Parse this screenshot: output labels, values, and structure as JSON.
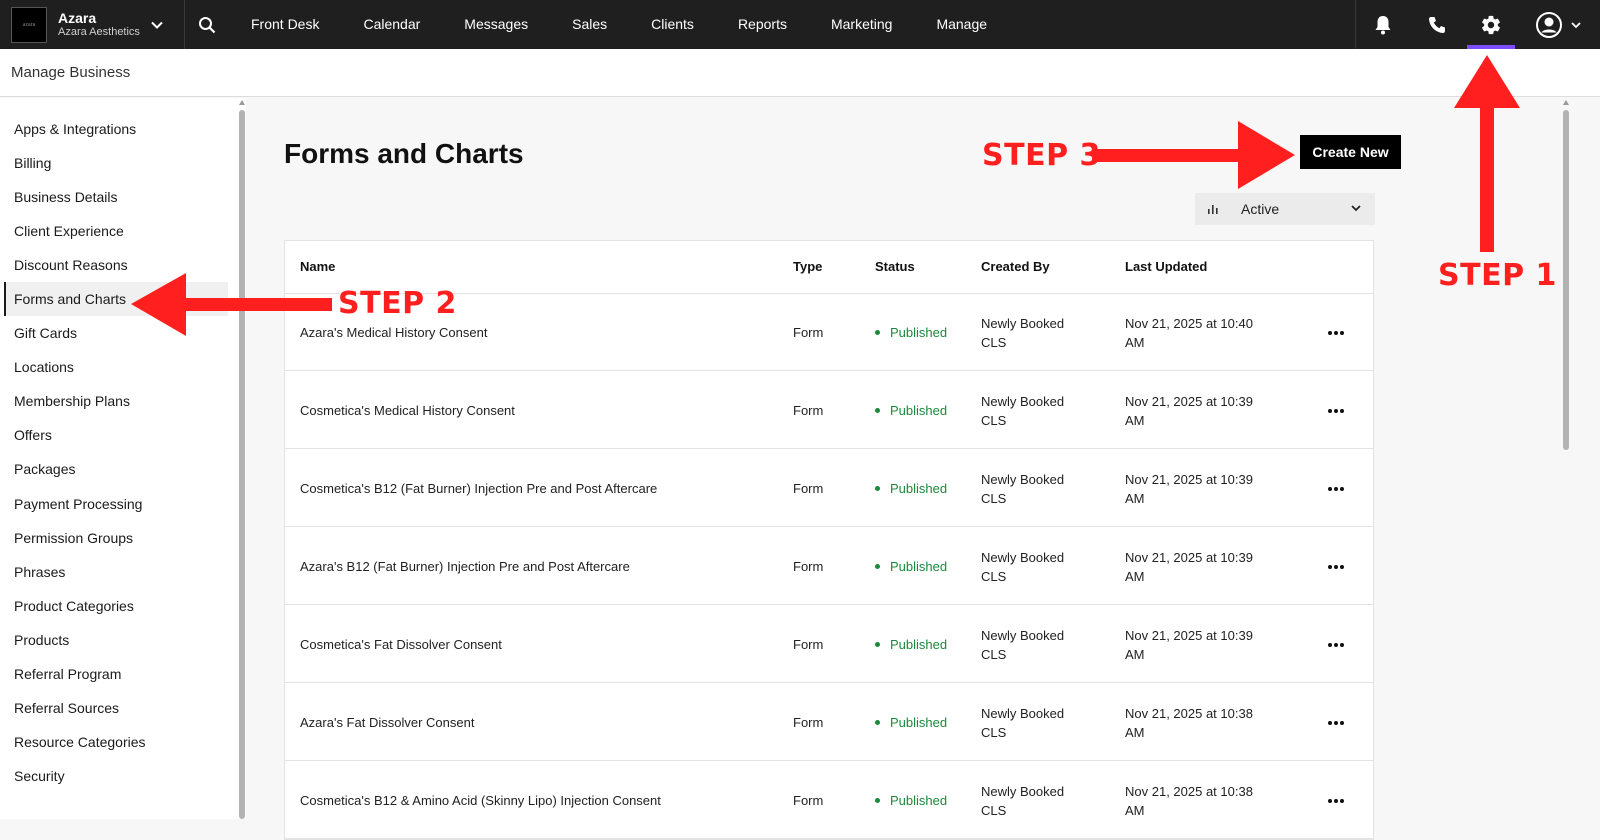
{
  "topbar": {
    "brand_name": "Azara",
    "brand_sub": "Azara Aesthetics",
    "nav": [
      "Front Desk",
      "Calendar",
      "Messages",
      "Sales",
      "Clients",
      "Reports",
      "Marketing",
      "Manage"
    ],
    "accent": "#7b4dff"
  },
  "subheader": {
    "title": "Manage Business"
  },
  "sidebar": {
    "items": [
      "Apps & Integrations",
      "Billing",
      "Business Details",
      "Client Experience",
      "Discount Reasons",
      "Forms and Charts",
      "Gift Cards",
      "Locations",
      "Membership Plans",
      "Offers",
      "Packages",
      "Payment Processing",
      "Permission Groups",
      "Phrases",
      "Product Categories",
      "Products",
      "Referral Program",
      "Referral Sources",
      "Resource Categories",
      "Security"
    ],
    "active_index": 5
  },
  "main": {
    "title": "Forms and Charts",
    "create_label": "Create New",
    "filter_value": "Active"
  },
  "table": {
    "headers": [
      "Name",
      "Type",
      "Status",
      "Created By",
      "Last Updated"
    ],
    "rows": [
      {
        "name": "Azara's Medical History Consent",
        "type": "Form",
        "status": "Published",
        "created_1": "Newly Booked",
        "created_2": "CLS",
        "updated_1": "Nov 21, 2025 at 10:40",
        "updated_2": "AM"
      },
      {
        "name": "Cosmetica's Medical History Consent",
        "type": "Form",
        "status": "Published",
        "created_1": "Newly Booked",
        "created_2": "CLS",
        "updated_1": "Nov 21, 2025 at 10:39",
        "updated_2": "AM"
      },
      {
        "name": "Cosmetica's B12 (Fat Burner) Injection Pre and Post Aftercare",
        "type": "Form",
        "status": "Published",
        "created_1": "Newly Booked",
        "created_2": "CLS",
        "updated_1": "Nov 21, 2025 at 10:39",
        "updated_2": "AM"
      },
      {
        "name": "Azara's B12 (Fat Burner) Injection Pre and Post Aftercare",
        "type": "Form",
        "status": "Published",
        "created_1": "Newly Booked",
        "created_2": "CLS",
        "updated_1": "Nov 21, 2025 at 10:39",
        "updated_2": "AM"
      },
      {
        "name": "Cosmetica's Fat Dissolver Consent",
        "type": "Form",
        "status": "Published",
        "created_1": "Newly Booked",
        "created_2": "CLS",
        "updated_1": "Nov 21, 2025 at 10:39",
        "updated_2": "AM"
      },
      {
        "name": "Azara's Fat Dissolver Consent",
        "type": "Form",
        "status": "Published",
        "created_1": "Newly Booked",
        "created_2": "CLS",
        "updated_1": "Nov 21, 2025 at 10:38",
        "updated_2": "AM"
      },
      {
        "name": "Cosmetica's B12 & Amino Acid (Skinny Lipo) Injection Consent",
        "type": "Form",
        "status": "Published",
        "created_1": "Newly Booked",
        "created_2": "CLS",
        "updated_1": "Nov 21, 2025 at 10:38",
        "updated_2": "AM"
      }
    ],
    "status_color": "#1a8a3c"
  },
  "annotations": {
    "step1": "STEP 1",
    "step2": "STEP 2",
    "step3": "STEP 3",
    "color": "#ff1f1f"
  }
}
